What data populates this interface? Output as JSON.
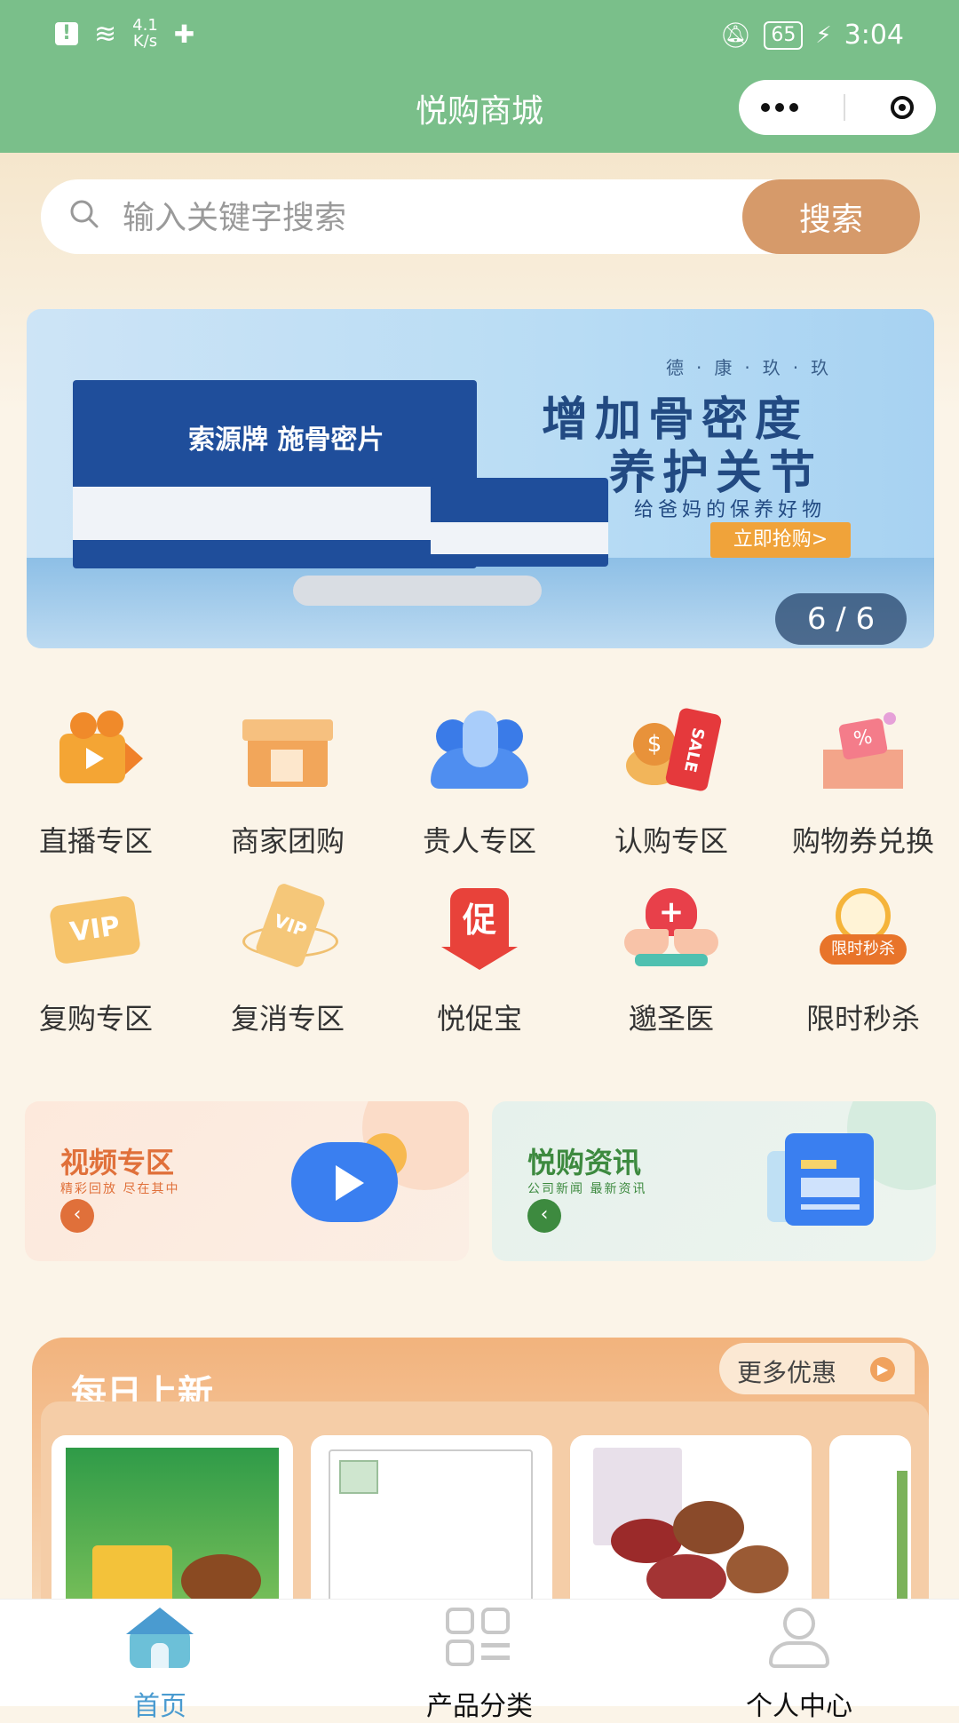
{
  "status_bar": {
    "net_speed_value": "4.1",
    "net_speed_unit": "K/s",
    "battery": "65",
    "time": "3:04"
  },
  "nav": {
    "title": "悦购商城"
  },
  "search": {
    "placeholder": "输入关键字搜索",
    "button": "搜索"
  },
  "banner": {
    "kicker": "德·康·玖·玖",
    "line1": "增加骨密度",
    "line2": "养护关节",
    "sub": "给爸妈的保养好物",
    "cta": "立即抢购>",
    "box_brand": "索源牌 施骨密片",
    "indicator": "6 / 6"
  },
  "grid": [
    {
      "label": "直播专区",
      "icon": "live-camera-icon"
    },
    {
      "label": "商家团购",
      "icon": "store-group-buy-icon"
    },
    {
      "label": "贵人专区",
      "icon": "vip-people-icon"
    },
    {
      "label": "认购专区",
      "icon": "sale-tag-icon"
    },
    {
      "label": "购物券兑换",
      "icon": "coupon-box-icon"
    },
    {
      "label": "复购专区",
      "icon": "vip-ticket-icon"
    },
    {
      "label": "复消专区",
      "icon": "vip-card-icon"
    },
    {
      "label": "悦促宝",
      "icon": "promo-icon"
    },
    {
      "label": "邈圣医",
      "icon": "medical-heart-icon"
    },
    {
      "label": "限时秒杀",
      "icon": "alarm-clock-icon"
    }
  ],
  "features": [
    {
      "title": "视频专区",
      "subtitle": "精彩回放 尽在其中",
      "color": "#e0703a",
      "icon": "video-play-icon"
    },
    {
      "title": "悦购资讯",
      "subtitle": "公司新闻 最新资讯",
      "color": "#3d8a3f",
      "icon": "news-doc-icon"
    }
  ],
  "daily": {
    "title": "每日上新",
    "more": "更多优惠"
  },
  "tabs": [
    {
      "label": "首页",
      "active": true,
      "icon": "home-icon"
    },
    {
      "label": "产品分类",
      "active": false,
      "icon": "category-grid-icon"
    },
    {
      "label": "个人中心",
      "active": false,
      "icon": "user-icon"
    }
  ],
  "colors": {
    "header_green": "#7abf8a",
    "search_button": "#d69a6a",
    "tab_active": "#4a9bd0",
    "orange_accent": "#f0a25e"
  }
}
